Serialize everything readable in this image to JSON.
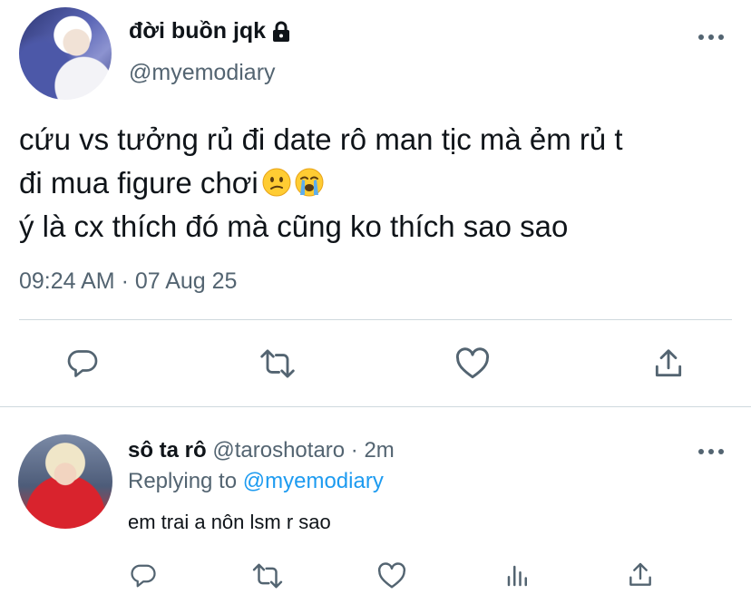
{
  "main_tweet": {
    "display_name": "đời buồn jqk",
    "handle": "@myemodiary",
    "text_line_1": "cứu vs tưởng rủ đi date rô man tịc mà ẻm rủ t",
    "text_line_2": "đi mua figure chơi",
    "text_line_3": "ý là cx thích đó mà cũng ko thích sao sao",
    "emojis": [
      "confused-face",
      "loudly-crying-face"
    ],
    "timestamp": "09:24 AM · 07 Aug 25",
    "protected": true,
    "icons": [
      "more-icon",
      "reply-icon",
      "retweet-icon",
      "like-icon",
      "share-icon"
    ]
  },
  "reply_tweet": {
    "display_name": "sô ta rô",
    "handle_time": "@taroshotaro · 2m",
    "replying_prefix": "Replying to",
    "replying_handle": "@myemodiary",
    "text": "em trai a nôn lsm r sao",
    "icons": [
      "more-icon",
      "reply-icon",
      "retweet-icon",
      "like-icon",
      "analytics-icon",
      "share-icon"
    ]
  },
  "colors": {
    "text": "#0f1419",
    "secondary": "#536471",
    "accent": "#1d9bf0",
    "divider": "#cfd9de"
  }
}
